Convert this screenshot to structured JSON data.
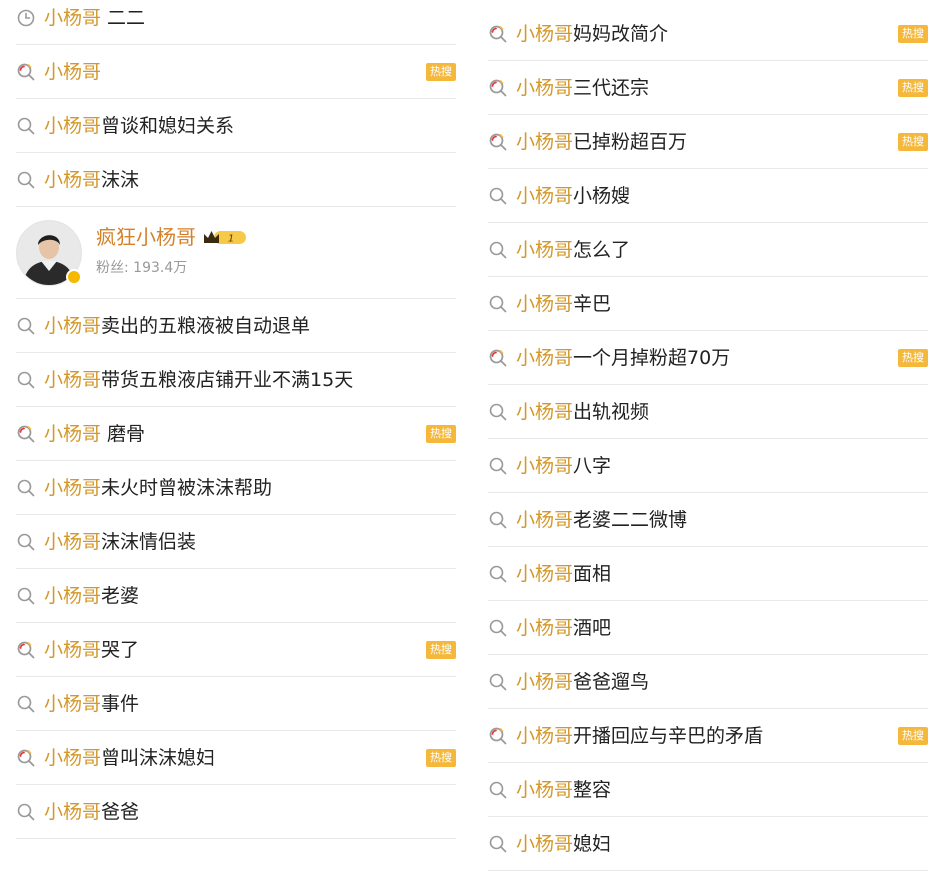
{
  "left_column": {
    "rows": [
      {
        "icon": "history-clock-icon",
        "keyword": "小杨哥",
        "suffix": "二二",
        "space": true,
        "hot": false
      },
      {
        "icon": "hot-search-icon",
        "keyword": "小杨哥",
        "suffix": "",
        "space": false,
        "hot": true
      },
      {
        "icon": "search-icon",
        "keyword": "小杨哥",
        "suffix": "曾谈和媳妇关系",
        "space": false,
        "hot": false
      },
      {
        "icon": "search-icon",
        "keyword": "小杨哥",
        "suffix": "沫沫",
        "space": false,
        "hot": false
      },
      {
        "type": "user",
        "name": "疯狂小杨哥",
        "level": "1",
        "fans": "粉丝: 193.4万"
      },
      {
        "icon": "search-icon",
        "keyword": "小杨哥",
        "suffix": "卖出的五粮液被自动退单",
        "space": false,
        "hot": false
      },
      {
        "icon": "search-icon",
        "keyword": "小杨哥",
        "suffix": "带货五粮液店铺开业不满15天",
        "space": false,
        "hot": false
      },
      {
        "icon": "hot-search-icon",
        "keyword": "小杨哥",
        "suffix": "磨骨",
        "space": true,
        "hot": true
      },
      {
        "icon": "search-icon",
        "keyword": "小杨哥",
        "suffix": "未火时曾被沫沫帮助",
        "space": false,
        "hot": false
      },
      {
        "icon": "search-icon",
        "keyword": "小杨哥",
        "suffix": "沫沫情侣装",
        "space": false,
        "hot": false
      },
      {
        "icon": "search-icon",
        "keyword": "小杨哥",
        "suffix": "老婆",
        "space": false,
        "hot": false
      },
      {
        "icon": "hot-search-icon",
        "keyword": "小杨哥",
        "suffix": "哭了",
        "space": false,
        "hot": true
      },
      {
        "icon": "search-icon",
        "keyword": "小杨哥",
        "suffix": "事件",
        "space": false,
        "hot": false
      },
      {
        "icon": "hot-search-icon",
        "keyword": "小杨哥",
        "suffix": "曾叫沫沫媳妇",
        "space": false,
        "hot": true
      },
      {
        "icon": "search-icon",
        "keyword": "小杨哥",
        "suffix": "爸爸",
        "space": false,
        "hot": false
      }
    ]
  },
  "right_column": {
    "rows": [
      {
        "icon": "hot-search-icon",
        "keyword": "小杨哥",
        "suffix": "妈妈改简介",
        "space": false,
        "hot": true
      },
      {
        "icon": "hot-search-icon",
        "keyword": "小杨哥",
        "suffix": "三代还宗",
        "space": false,
        "hot": true
      },
      {
        "icon": "hot-search-icon",
        "keyword": "小杨哥",
        "suffix": "已掉粉超百万",
        "space": false,
        "hot": true
      },
      {
        "icon": "search-icon",
        "keyword": "小杨哥",
        "suffix": "小杨嫂",
        "space": false,
        "hot": false
      },
      {
        "icon": "search-icon",
        "keyword": "小杨哥",
        "suffix": "怎么了",
        "space": false,
        "hot": false
      },
      {
        "icon": "search-icon",
        "keyword": "小杨哥",
        "suffix": "辛巴",
        "space": false,
        "hot": false
      },
      {
        "icon": "hot-search-icon",
        "keyword": "小杨哥",
        "suffix": "一个月掉粉超70万",
        "space": false,
        "hot": true
      },
      {
        "icon": "search-icon",
        "keyword": "小杨哥",
        "suffix": "出轨视频",
        "space": false,
        "hot": false
      },
      {
        "icon": "search-icon",
        "keyword": "小杨哥",
        "suffix": "八字",
        "space": false,
        "hot": false
      },
      {
        "icon": "search-icon",
        "keyword": "小杨哥",
        "suffix": "老婆二二微博",
        "space": false,
        "hot": false
      },
      {
        "icon": "search-icon",
        "keyword": "小杨哥",
        "suffix": "面相",
        "space": false,
        "hot": false
      },
      {
        "icon": "search-icon",
        "keyword": "小杨哥",
        "suffix": "酒吧",
        "space": false,
        "hot": false
      },
      {
        "icon": "search-icon",
        "keyword": "小杨哥",
        "suffix": "爸爸遛鸟",
        "space": false,
        "hot": false
      },
      {
        "icon": "hot-search-icon",
        "keyword": "小杨哥",
        "suffix": "开播回应与辛巴的矛盾",
        "space": false,
        "hot": true
      },
      {
        "icon": "search-icon",
        "keyword": "小杨哥",
        "suffix": "整容",
        "space": false,
        "hot": false
      },
      {
        "icon": "search-icon",
        "keyword": "小杨哥",
        "suffix": "媳妇",
        "space": false,
        "hot": false
      }
    ]
  },
  "hot_badge_label": "热搜",
  "colors": {
    "keyword": "#d4982a",
    "hot_badge": "#f5b83a",
    "username": "#d4822a",
    "divider": "#e8e8e8",
    "hot_icon_accent": "#e4393c"
  }
}
